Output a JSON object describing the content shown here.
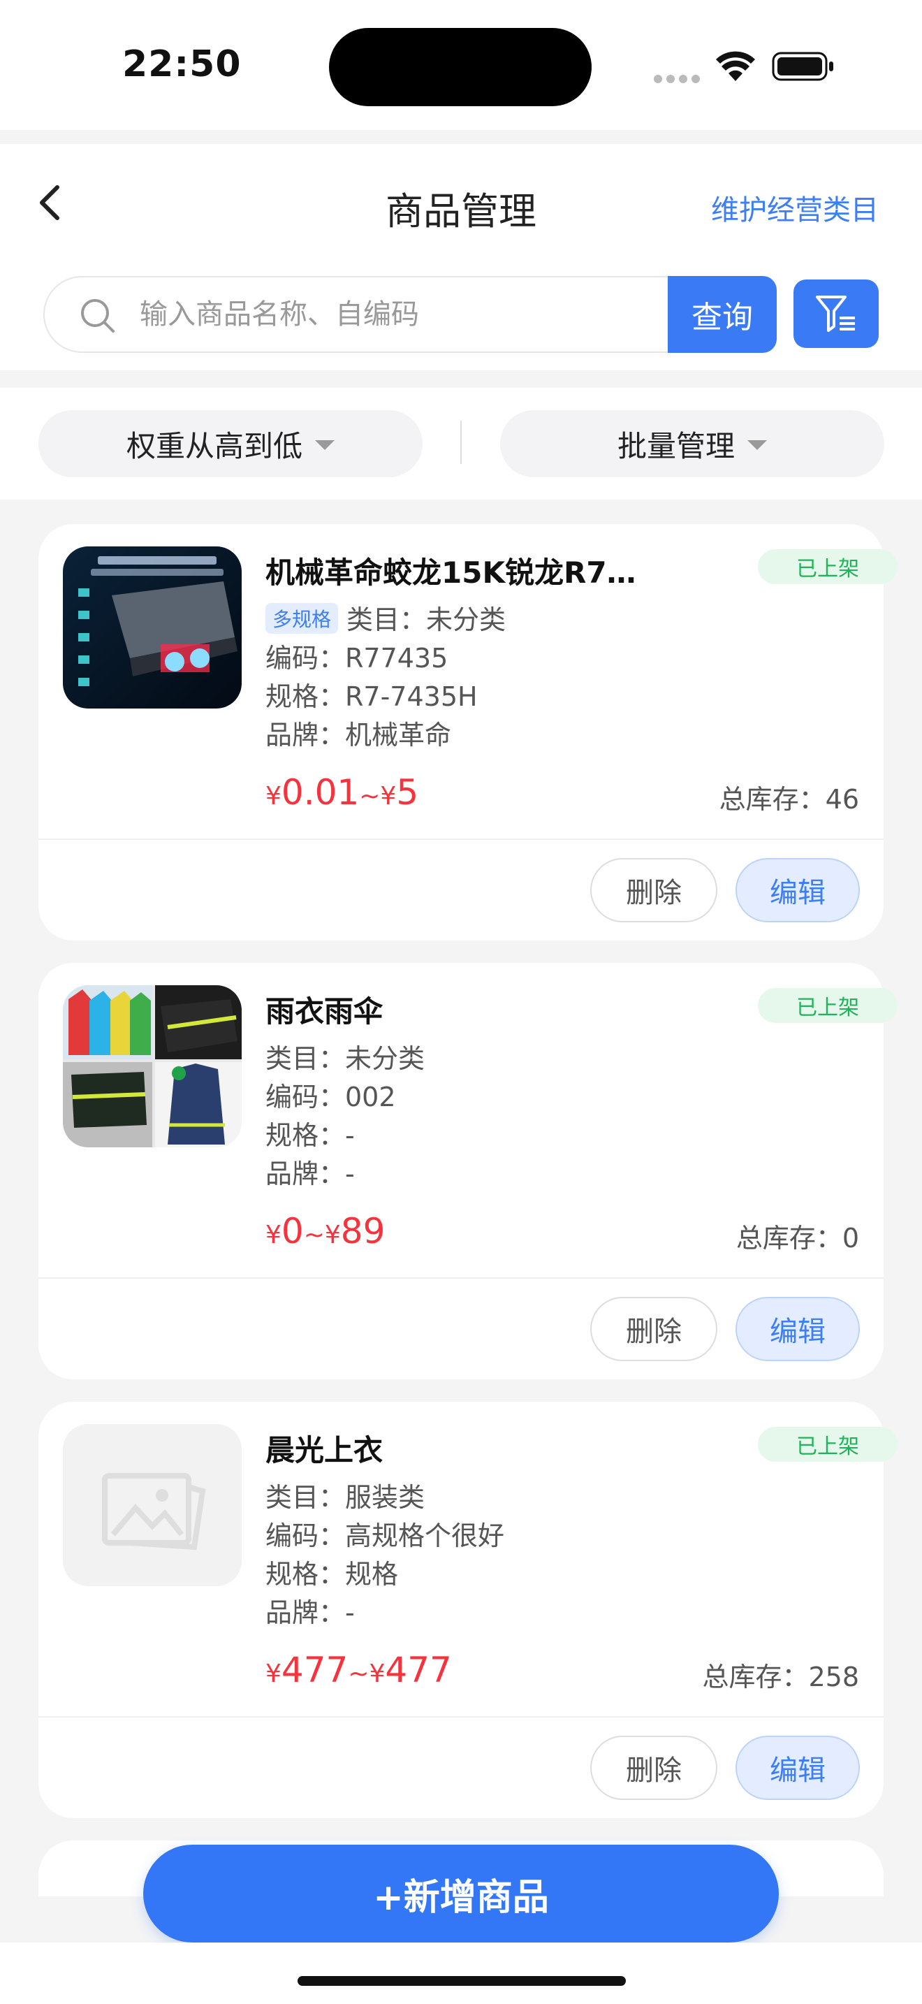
{
  "status_bar": {
    "time": "22:50"
  },
  "header": {
    "title": "商品管理",
    "link": "维护经营类目"
  },
  "search": {
    "placeholder": "输入商品名称、自编码",
    "value": "",
    "button": "查询"
  },
  "sort_bar": {
    "sort_label": "权重从高到低",
    "batch_label": "批量管理"
  },
  "products": [
    {
      "name": "机械革命蛟龙15K锐龙R7…",
      "status": "已上架",
      "multi_spec_tag": "多规格",
      "category": "类目：未分类",
      "code": "编码：R77435",
      "spec": "规格：R7-7435H",
      "brand": "品牌：机械革命",
      "price_prefix": "¥",
      "price_low": "0.01",
      "price_sep": "~¥",
      "price_high": "5",
      "stock": "总库存：46",
      "delete": "删除",
      "edit": "编辑"
    },
    {
      "name": "雨衣雨伞",
      "status": "已上架",
      "category": "类目：未分类",
      "code": "编码：002",
      "spec": "规格：-",
      "brand": "品牌：-",
      "price_prefix": "¥",
      "price_low": "0",
      "price_sep": "~¥",
      "price_high": "89",
      "stock": "总库存：0",
      "delete": "删除",
      "edit": "编辑"
    },
    {
      "name": "晨光上衣",
      "status": "已上架",
      "category": "类目：服装类",
      "code": "编码：高规格个很好",
      "spec": "规格：规格",
      "brand": "品牌：-",
      "price_prefix": "¥",
      "price_low": "477",
      "price_sep": "~¥",
      "price_high": "477",
      "stock": "总库存：258",
      "delete": "删除",
      "edit": "编辑"
    }
  ],
  "footer": {
    "add_button": "+新增商品"
  },
  "colors": {
    "primary": "#3a7bf5",
    "price": "#f4333c",
    "status_green": "#21b35a",
    "status_bg": "#e6f8ec"
  }
}
